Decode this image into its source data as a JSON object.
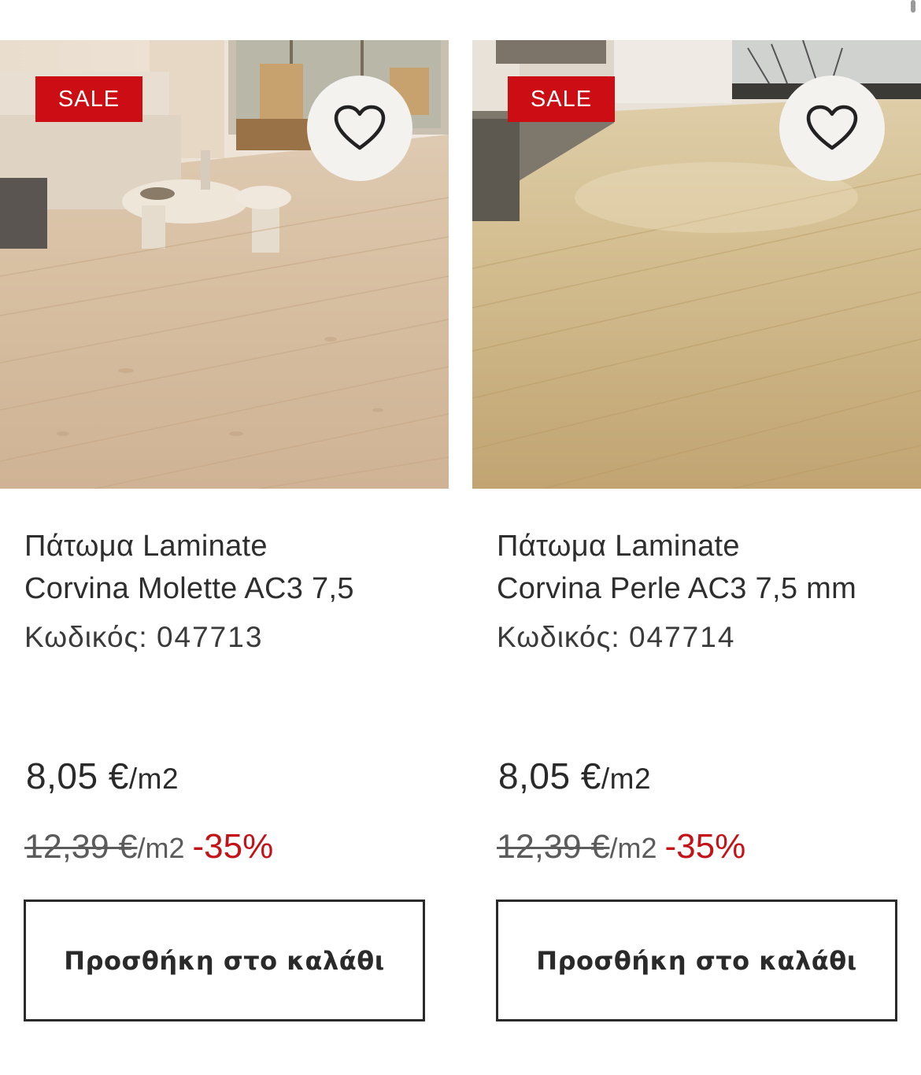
{
  "products": [
    {
      "badge": "SALE",
      "wishlist_icon": "heart-outline-icon",
      "title_line1": "Πάτωμα Laminate",
      "title_line2": "Corvina Molette AC3 7,5",
      "sku_label": "Κωδικός:",
      "sku": "047713",
      "price": "8,05 €",
      "price_unit": "/m2",
      "old_price": "12,39 €",
      "old_price_unit": "/m2",
      "discount": "-35%",
      "cart_label": "Προσθήκη στο καλάθι"
    },
    {
      "badge": "SALE",
      "wishlist_icon": "heart-outline-icon",
      "title_line1": "Πάτωμα Laminate",
      "title_line2": "Corvina Perle AC3 7,5 mm",
      "sku_label": "Κωδικός:",
      "sku": "047714",
      "price": "8,05 €",
      "price_unit": "/m2",
      "old_price": "12,39 €",
      "old_price_unit": "/m2",
      "discount": "-35%",
      "cart_label": "Προσθήκη στο καλάθι"
    }
  ],
  "colors": {
    "sale_badge": "#cc0e14",
    "discount": "#c41218",
    "wishlist_bg": "#f4f2ef"
  }
}
